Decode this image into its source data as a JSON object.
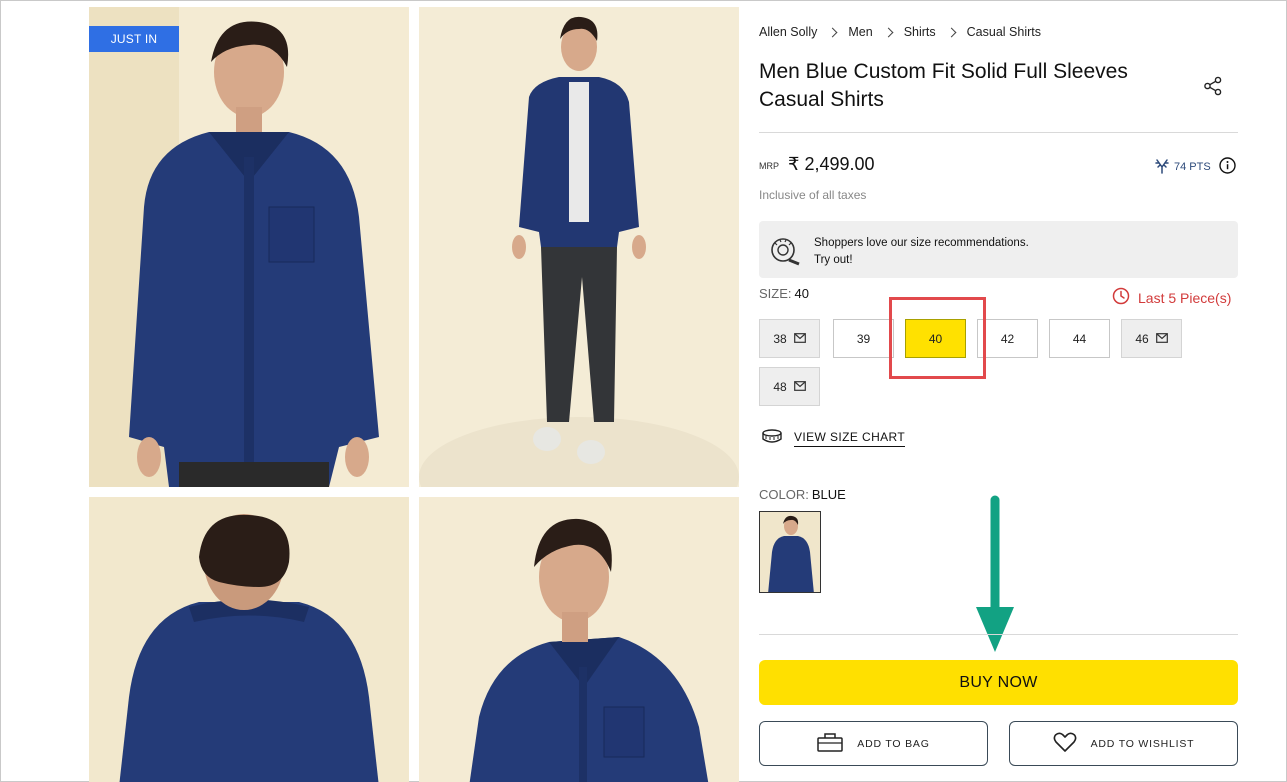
{
  "badge": "JUST IN",
  "breadcrumb": [
    "Allen Solly",
    "Men",
    "Shirts",
    "Casual Shirts"
  ],
  "product": {
    "title": "Men Blue Custom Fit Solid Full Sleeves Casual Shirts",
    "mrp_label": "MRP",
    "price": "₹ 2,499.00",
    "points": "74 PTS",
    "taxes_note": "Inclusive of all taxes"
  },
  "size_reco": {
    "line1": "Shoppers love our size recommendations.",
    "line2": "Try out!"
  },
  "size": {
    "label": "SIZE:",
    "selected": "40",
    "stock_note": "Last 5 Piece(s)",
    "options": [
      {
        "value": "38",
        "state": "out-of-stock"
      },
      {
        "value": "39",
        "state": "available"
      },
      {
        "value": "40",
        "state": "selected"
      },
      {
        "value": "42",
        "state": "available"
      },
      {
        "value": "44",
        "state": "available"
      },
      {
        "value": "46",
        "state": "out-of-stock"
      },
      {
        "value": "48",
        "state": "out-of-stock"
      }
    ],
    "size_chart_link": "VIEW SIZE CHART"
  },
  "color": {
    "label": "COLOR:",
    "selected": "BLUE"
  },
  "actions": {
    "buy_now": "BUY NOW",
    "add_to_bag": "ADD TO BAG",
    "add_to_wishlist": "ADD TO WISHLIST"
  },
  "colors": {
    "accent_yellow": "#ffe100",
    "badge_blue": "#2f6fe4",
    "stock_red": "#d23b3b",
    "highlight_red": "#e2494c",
    "annotation_arrow": "#12a283",
    "shirt_blue": "#1f3570"
  },
  "icons": [
    "share-icon",
    "antler-points-icon",
    "info-icon",
    "measuring-tape-icon",
    "clock-icon",
    "mail-icon",
    "bag-icon",
    "heart-icon",
    "down-arrow-annotation"
  ]
}
